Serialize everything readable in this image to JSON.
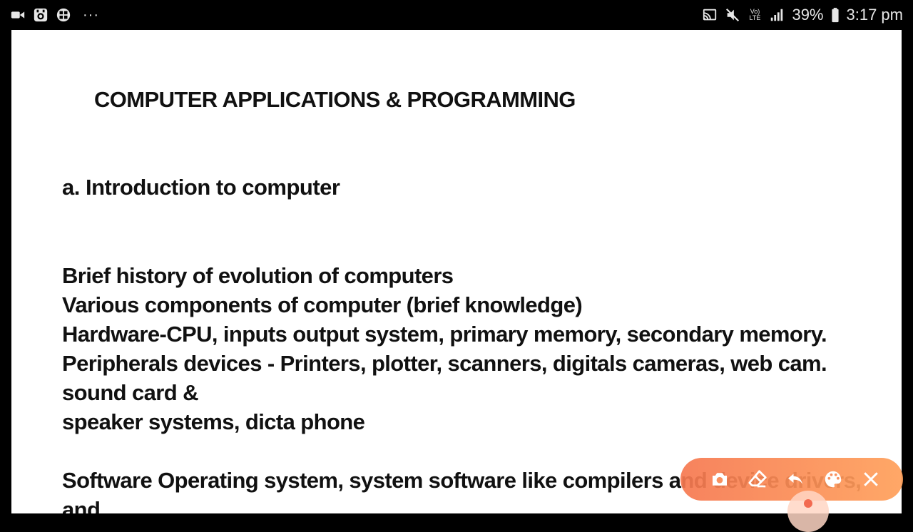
{
  "status_bar": {
    "left_icons": [
      "video-camera-icon",
      "recorder-icon",
      "gallery-icon"
    ],
    "overflow_dots": "···",
    "right_icons": [
      "cast-icon",
      "mute-icon",
      "volte-icon",
      "signal-icon",
      "battery-icon"
    ],
    "volte_line1": "Vo)",
    "volte_line2": "LTE",
    "battery_percent": "39%",
    "time": "3:17 pm"
  },
  "document": {
    "title": "COMPUTER APPLICATIONS & PROGRAMMING",
    "section_heading": "a. Introduction to computer",
    "lines": [
      "Brief history of evolution of computers",
      "Various components of computer (brief knowledge)",
      "Hardware-CPU, inputs output system, primary memory, secondary memory.",
      "Peripherals devices - Printers, plotter, scanners, digitals cameras, web cam.",
      "sound card &",
      "speaker systems, dicta phone",
      "",
      "Software Operating system, system software like compilers and device drivers,",
      "and"
    ]
  },
  "toolbar": {
    "buttons": [
      "camera-icon",
      "eraser-icon",
      "undo-icon",
      "palette-icon",
      "close-icon"
    ],
    "colors": {
      "start": "#f67850",
      "end": "#ffa05a"
    }
  }
}
